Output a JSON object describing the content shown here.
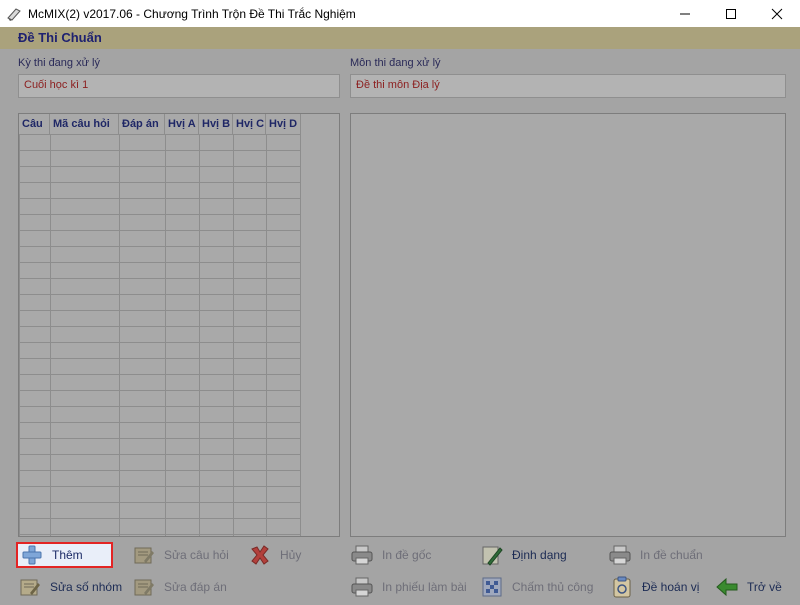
{
  "window": {
    "title": "McMIX(2) v2017.06 - Chương Trình Trộn Đề Thi Trắc Nghiệm",
    "controls": [
      "minimize",
      "maximize",
      "close"
    ]
  },
  "header": {
    "title": "Đề Thi Chuẩn"
  },
  "exam": {
    "label": "Kỳ thi đang xử lý",
    "value": "Cuối học kì 1"
  },
  "subject": {
    "label": "Môn thi đang xử lý",
    "value": "Đề thi môn Địa lý"
  },
  "grid": {
    "columns": [
      "Câu",
      "Mã câu hỏi",
      "Đáp án",
      "Hvị A",
      "Hvị B",
      "Hvị C",
      "Hvị D"
    ],
    "rows": []
  },
  "buttons": {
    "them": "Thêm",
    "sua_cau_hoi": "Sửa câu hỏi",
    "huy": "Hủy",
    "in_de_goc": "In đề gốc",
    "dinh_dang": "Định dạng",
    "in_de_chuan": "In đề chuẩn",
    "sua_so_nhom": "Sửa số nhóm",
    "sua_dap_an": "Sửa đáp án",
    "in_phieu_lam_bai": "In phiếu làm bài",
    "cham_thu_cong": "Chấm thủ công",
    "de_hoan_vi": "Đề hoán vị",
    "tro_ve": "Trở về"
  },
  "colors": {
    "header_title": "#1e2170",
    "field_value": "#8c2020",
    "highlight_border": "#e32424"
  }
}
